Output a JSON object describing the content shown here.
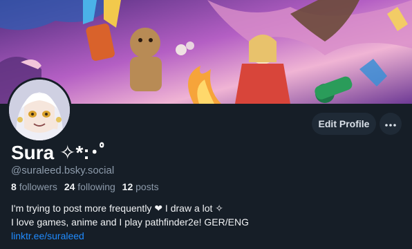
{
  "profile": {
    "display_name": "Sura ✧*:･ﾟ",
    "handle": "@suraleed.bsky.social",
    "stats": {
      "followers_count": "8",
      "followers_label": "followers",
      "following_count": "24",
      "following_label": "following",
      "posts_count": "12",
      "posts_label": "posts"
    },
    "bio": {
      "line1": "I'm trying to post more frequently ❤ I draw a lot ✧",
      "line2": "I love games, anime and I play pathfinder2e! GER/ENG",
      "link": "linktr.ee/suraleed"
    }
  },
  "actions": {
    "edit_profile": "Edit Profile",
    "more_icon": "ellipsis-icon"
  },
  "colors": {
    "background": "#161e27",
    "button_bg": "#1f2a36",
    "muted_text": "#8d9bab",
    "link": "#208bfe"
  }
}
